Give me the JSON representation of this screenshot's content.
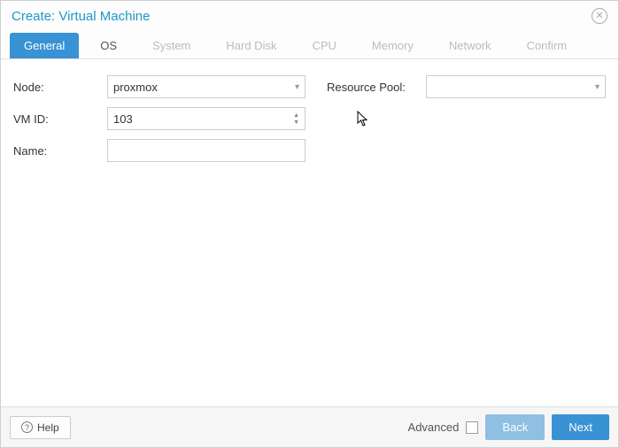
{
  "title": "Create: Virtual Machine",
  "tabs": [
    {
      "label": "General",
      "active": true
    },
    {
      "label": "OS",
      "enabled": true
    },
    {
      "label": "System"
    },
    {
      "label": "Hard Disk"
    },
    {
      "label": "CPU"
    },
    {
      "label": "Memory"
    },
    {
      "label": "Network"
    },
    {
      "label": "Confirm"
    }
  ],
  "form": {
    "node_label": "Node:",
    "node_value": "proxmox",
    "vmid_label": "VM ID:",
    "vmid_value": "103",
    "name_label": "Name:",
    "name_value": "",
    "pool_label": "Resource Pool:",
    "pool_value": ""
  },
  "footer": {
    "help": "Help",
    "advanced": "Advanced",
    "back": "Back",
    "next": "Next"
  }
}
